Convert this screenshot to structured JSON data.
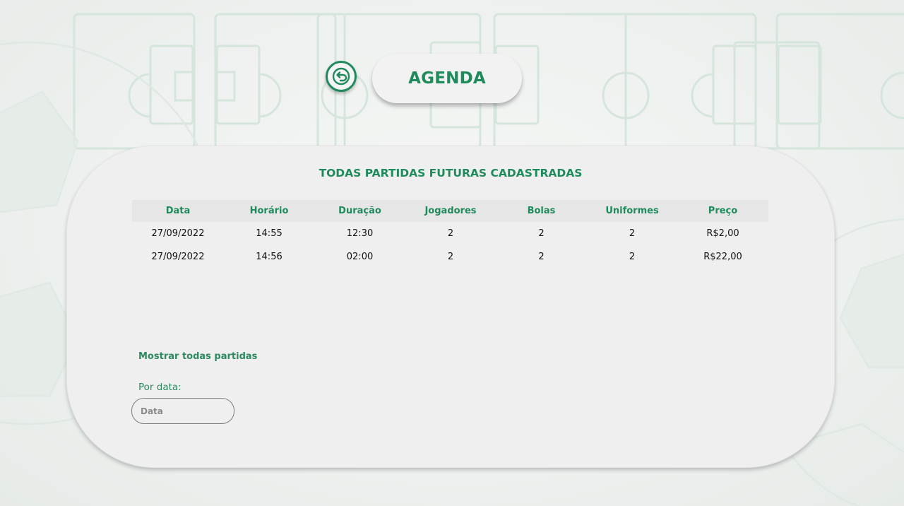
{
  "header": {
    "title": "AGENDA",
    "back_icon": "back-arrow-icon"
  },
  "panel": {
    "title": "TODAS PARTIDAS FUTURAS CADASTRADAS"
  },
  "table": {
    "columns": [
      "Data",
      "Horário",
      "Duração",
      "Jogadores",
      "Bolas",
      "Uniformes",
      "Preço"
    ],
    "rows": [
      [
        "27/09/2022",
        "14:55",
        "12:30",
        "2",
        "2",
        "2",
        "R$2,00"
      ],
      [
        "27/09/2022",
        "14:56",
        "02:00",
        "2",
        "2",
        "2",
        "R$22,00"
      ]
    ]
  },
  "filters": {
    "show_all_label": "Mostrar todas partidas",
    "by_date_label": "Por data:",
    "date_placeholder": "Data"
  },
  "colors": {
    "accent": "#1f8a5b",
    "panel": "#efefef",
    "background": "#eef1ef"
  }
}
